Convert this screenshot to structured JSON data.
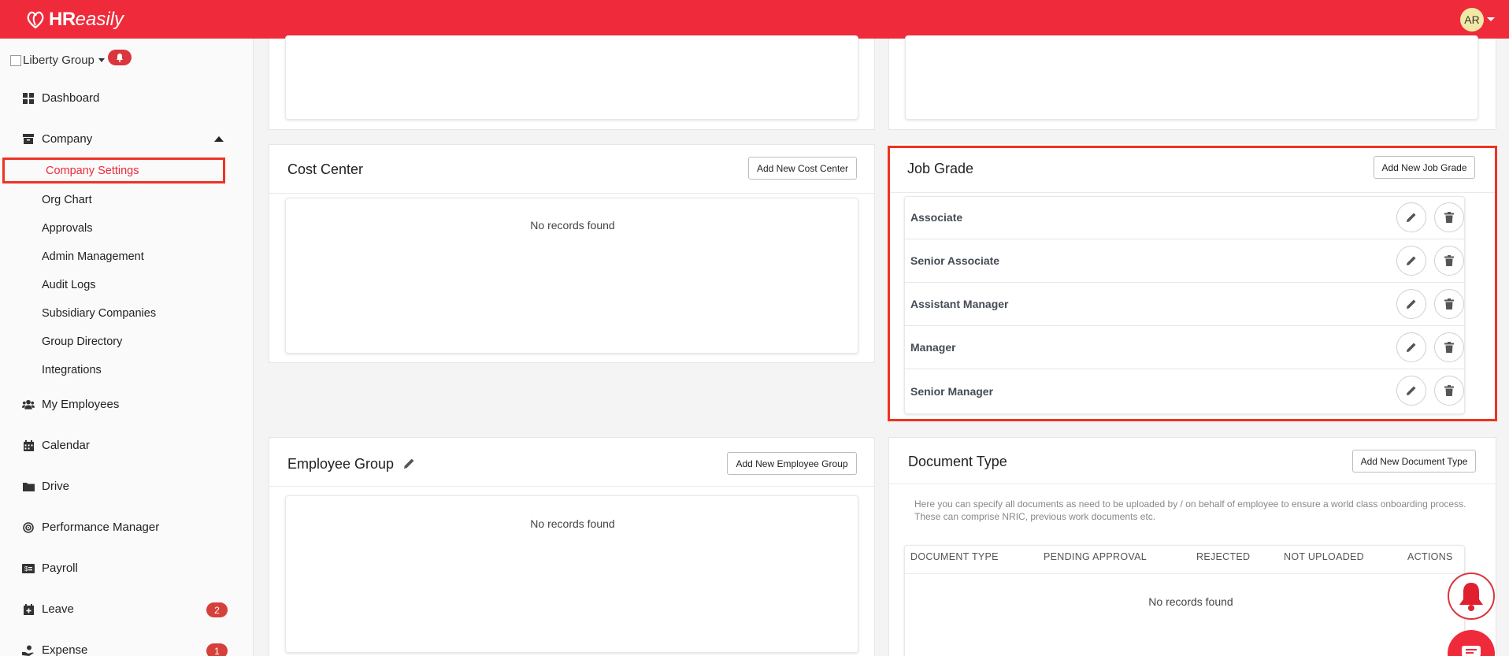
{
  "brand": {
    "hr": "HR",
    "easily": "easily"
  },
  "user": {
    "initials": "AR"
  },
  "sidebar": {
    "org_name": "Liberty Group",
    "items": {
      "dashboard": "Dashboard",
      "company": "Company",
      "company_settings": "Company Settings",
      "org_chart": "Org Chart",
      "approvals": "Approvals",
      "admin_management": "Admin Management",
      "audit_logs": "Audit Logs",
      "subsidiary_companies": "Subsidiary Companies",
      "group_directory": "Group Directory",
      "integrations": "Integrations",
      "my_employees": "My Employees",
      "calendar": "Calendar",
      "drive": "Drive",
      "performance_manager": "Performance Manager",
      "payroll": "Payroll",
      "leave": "Leave",
      "expense": "Expense"
    },
    "badges": {
      "leave": "2",
      "expense": "1"
    }
  },
  "cost_center": {
    "title": "Cost Center",
    "add_button": "Add New Cost Center",
    "empty_text": "No records found"
  },
  "job_grade": {
    "title": "Job Grade",
    "add_button": "Add New Job Grade",
    "rows": [
      "Associate",
      "Senior Associate",
      "Assistant Manager",
      "Manager",
      "Senior Manager"
    ]
  },
  "employee_group": {
    "title": "Employee Group",
    "add_button": "Add New Employee Group",
    "empty_text": "No records found"
  },
  "document_type": {
    "title": "Document Type",
    "add_button": "Add New Document Type",
    "description": "Here you can specify all documents as need to be uploaded by / on behalf of employee to ensure a world class onboarding process. These can comprise NRIC, previous work documents etc.",
    "columns": [
      "DOCUMENT TYPE",
      "PENDING APPROVAL",
      "REJECTED",
      "NOT UPLOADED",
      "ACTIONS"
    ],
    "empty_text": "No records found"
  },
  "colors": {
    "brand_red": "#ef2b3b",
    "highlight": "#ee3322",
    "badge_red": "#d6403a"
  }
}
